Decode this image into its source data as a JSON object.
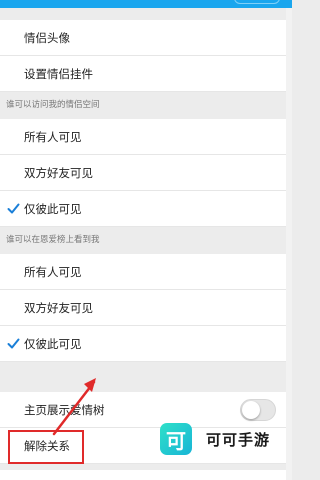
{
  "colors": {
    "accent": "#1aa6ee",
    "check": "#1a7fd8",
    "highlight": "#e02a2a"
  },
  "settings": {
    "avatar_label": "情侣头像",
    "pendant_label": "设置情侣挂件",
    "visit_section": {
      "header": "谁可以访问我的情侣空间",
      "options": [
        "所有人可见",
        "双方好友可见",
        "仅彼此可见"
      ],
      "selected_index": 2
    },
    "ranking_section": {
      "header": "谁可以在恩爱榜上看到我",
      "options": [
        "所有人可见",
        "双方好友可见",
        "仅彼此可见"
      ],
      "selected_index": 2
    },
    "homepage_tree_label": "主页展示爱情树",
    "homepage_tree_enabled": false,
    "unbind_label": "解除关系"
  },
  "watermark": {
    "logo_char": "可",
    "text": "可可手游"
  }
}
